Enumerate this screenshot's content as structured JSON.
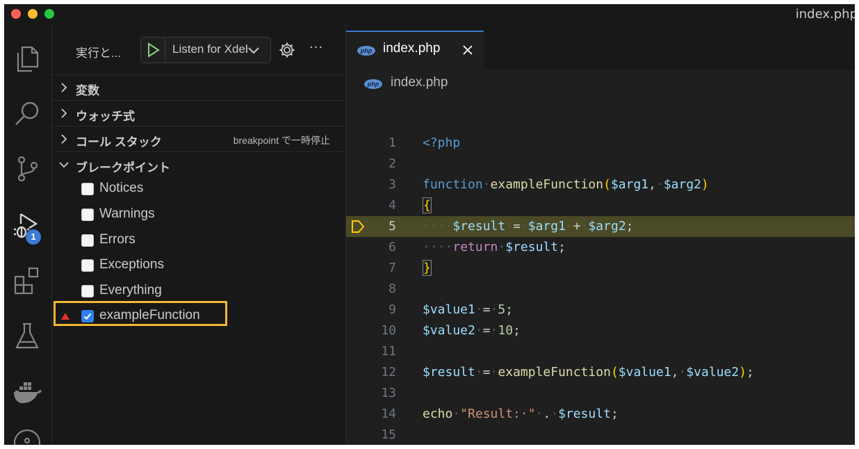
{
  "window": {
    "title": "index.php"
  },
  "activity_bar": {
    "items": [
      "explorer-icon",
      "search-icon",
      "source-control-icon",
      "run-debug-icon",
      "extensions-icon",
      "testing-icon",
      "docker-icon",
      "git-graph-icon"
    ],
    "debug_badge": "1"
  },
  "sidebar": {
    "title": "実行と...",
    "run_config": "Listen for Xdebug",
    "sections": {
      "variables": "変数",
      "watch": "ウォッチ式",
      "call_stack": "コール スタック",
      "call_stack_status": "breakpoint で一時停止",
      "breakpoints": "ブレークポイント"
    },
    "breakpoints": [
      {
        "label": "Notices",
        "checked": false
      },
      {
        "label": "Warnings",
        "checked": false
      },
      {
        "label": "Errors",
        "checked": false
      },
      {
        "label": "Exceptions",
        "checked": false
      },
      {
        "label": "Everything",
        "checked": false
      },
      {
        "label": "exampleFunction",
        "checked": true
      }
    ]
  },
  "editor": {
    "tab": {
      "label": "index.php",
      "icon": "php-icon"
    },
    "breadcrumb": "index.php",
    "current_line": 5,
    "lines": [
      {
        "n": "1",
        "text": "<?php"
      },
      {
        "n": "2",
        "text": ""
      },
      {
        "n": "3",
        "text": "function exampleFunction($arg1, $arg2)"
      },
      {
        "n": "4",
        "text": "{"
      },
      {
        "n": "5",
        "text": "    $result = $arg1 + $arg2;"
      },
      {
        "n": "6",
        "text": "    return $result;"
      },
      {
        "n": "7",
        "text": "}"
      },
      {
        "n": "8",
        "text": ""
      },
      {
        "n": "9",
        "text": "$value1 = 5;"
      },
      {
        "n": "10",
        "text": "$value2 = 10;"
      },
      {
        "n": "11",
        "text": ""
      },
      {
        "n": "12",
        "text": "$result = exampleFunction($value1, $value2);"
      },
      {
        "n": "13",
        "text": ""
      },
      {
        "n": "14",
        "text": "echo \"Result: \" . $result;"
      },
      {
        "n": "15",
        "text": ""
      }
    ]
  },
  "colors": {
    "accent": "#3a7bd5",
    "highlight_box": "#f2b736",
    "current_line": "#4b4a26",
    "function_breakpoint": "#e5322d"
  }
}
